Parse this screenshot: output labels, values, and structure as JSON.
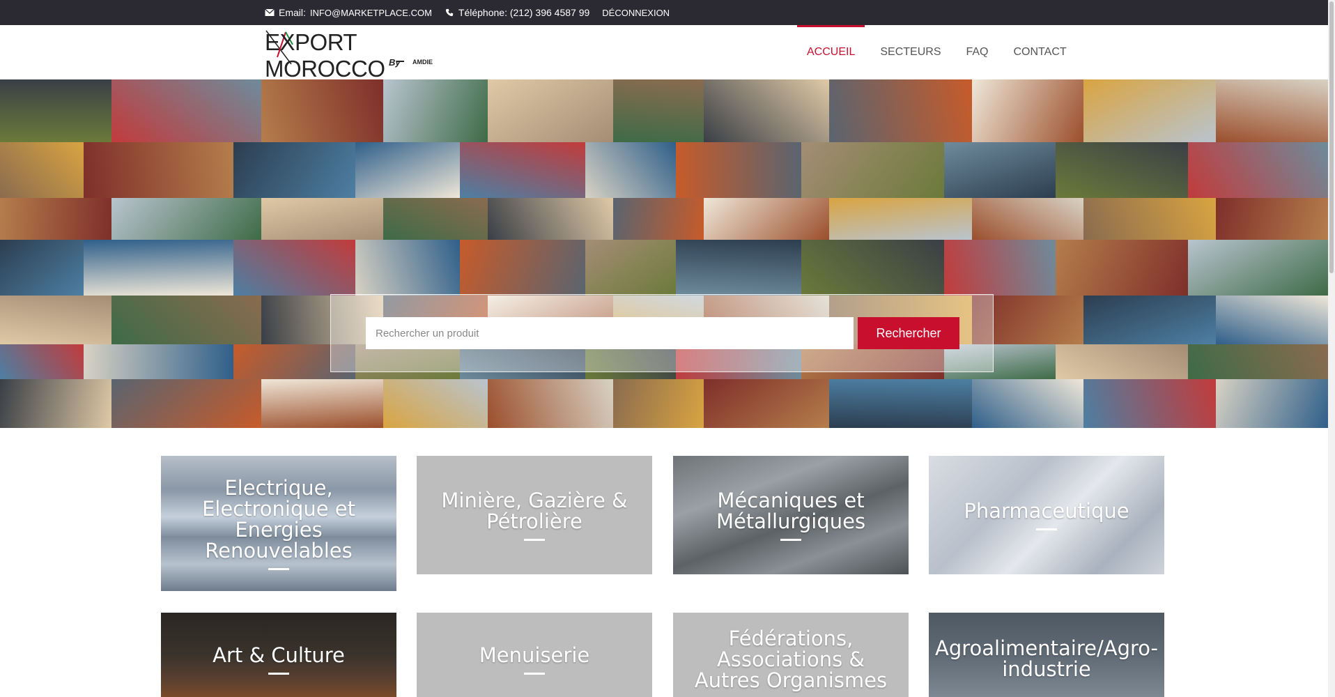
{
  "topbar": {
    "email_label": "Email:",
    "email_value": "INFO@MARKETPLACE.COM",
    "phone_label": "Téléphone: (212) 396 4587 99",
    "logout": "DÉCONNEXION"
  },
  "header": {
    "logo_text": "EXPORT MOROCCO",
    "logo_by": "By",
    "logo_amdie": "AMDIE",
    "nav": [
      {
        "label": "ACCUEIL",
        "active": true
      },
      {
        "label": "SECTEURS",
        "active": false
      },
      {
        "label": "FAQ",
        "active": false
      },
      {
        "label": "CONTACT",
        "active": false
      }
    ]
  },
  "search": {
    "placeholder": "Rechercher un produit",
    "button": "Rechercher"
  },
  "sectors": [
    {
      "label": "Electrique, Electronique et Energies Renouvelables"
    },
    {
      "label": "Minière, Gazière & Pétrolière"
    },
    {
      "label": "Mécaniques et Métallurgiques"
    },
    {
      "label": "Pharmaceutique"
    },
    {
      "label": "Art & Culture"
    },
    {
      "label": "Menuiserie"
    },
    {
      "label": "Fédérations, Associations & Autres Organismes"
    },
    {
      "label": "Agroalimentaire/Agro-industrie"
    }
  ],
  "colors": {
    "accent": "#c8102e",
    "topbar": "#2b2a33"
  }
}
